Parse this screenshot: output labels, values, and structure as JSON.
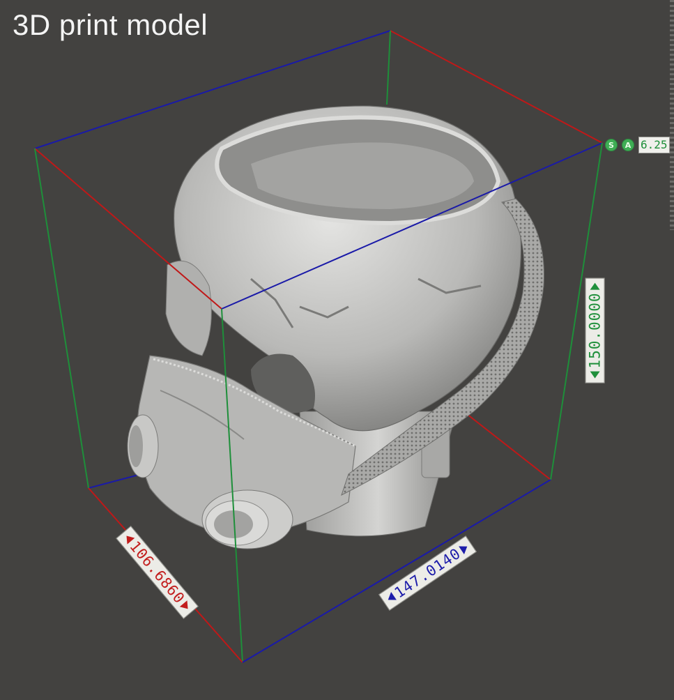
{
  "title": "3D print model",
  "status": {
    "snap_label": "S",
    "angle_label": "A",
    "value": "6.25"
  },
  "dimensions": {
    "depth": "106.6860",
    "width": "147.0140",
    "height": "150.0000"
  },
  "colors": {
    "background": "#434240",
    "x_axis": "#c01818",
    "y_axis": "#1a1aa8",
    "z_axis": "#1e8f3a",
    "model": "#bdbdbd"
  },
  "icons": [
    "snap-icon",
    "angle-icon",
    "arrow-left-icon",
    "arrow-right-icon"
  ]
}
